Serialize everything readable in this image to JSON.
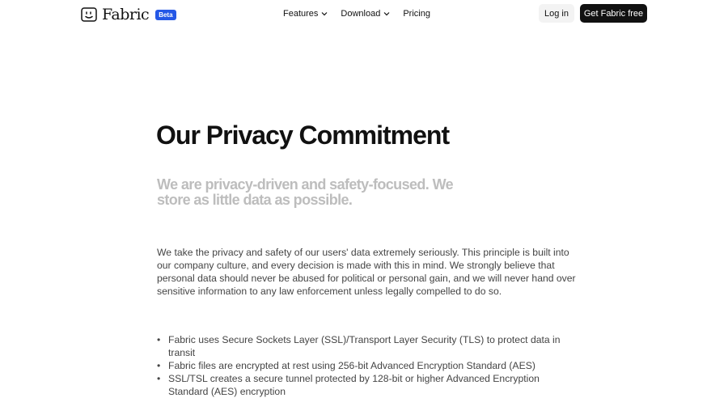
{
  "nav": {
    "logo_text": "Fabric",
    "beta_badge": "Beta",
    "menu": {
      "features": "Features",
      "download": "Download",
      "pricing": "Pricing"
    },
    "login": "Log in",
    "cta": "Get Fabric free"
  },
  "main": {
    "title": "Our Privacy Commitment",
    "subtitle": "We are privacy-driven and safety-focused. We store as little data as possible.",
    "paragraph": "We take the privacy and safety of our users' data extremely seriously. This principle is built into our company culture, and every decision is made with this in mind. We strongly believe that personal data should never be abused for political or personal gain, and we will never hand over sensitive information to any law enforcement unless legally compelled to do so.",
    "bullets": [
      "Fabric uses Secure Sockets Layer (SSL)/Transport Layer Security (TLS) to protect data in transit",
      "Fabric files are encrypted at rest using 256-bit Advanced Encryption Standard (AES)",
      "SSL/TSL creates a secure tunnel protected by 128-bit or higher Advanced Encryption Standard (AES) encryption"
    ]
  },
  "colors": {
    "brand_badge": "#2558e6",
    "cta_background": "#111111",
    "subtitle_text": "#bdbdbd"
  },
  "icons": {
    "logo": "smiley-face-icon",
    "dropdown": "chevron-down-icon"
  }
}
